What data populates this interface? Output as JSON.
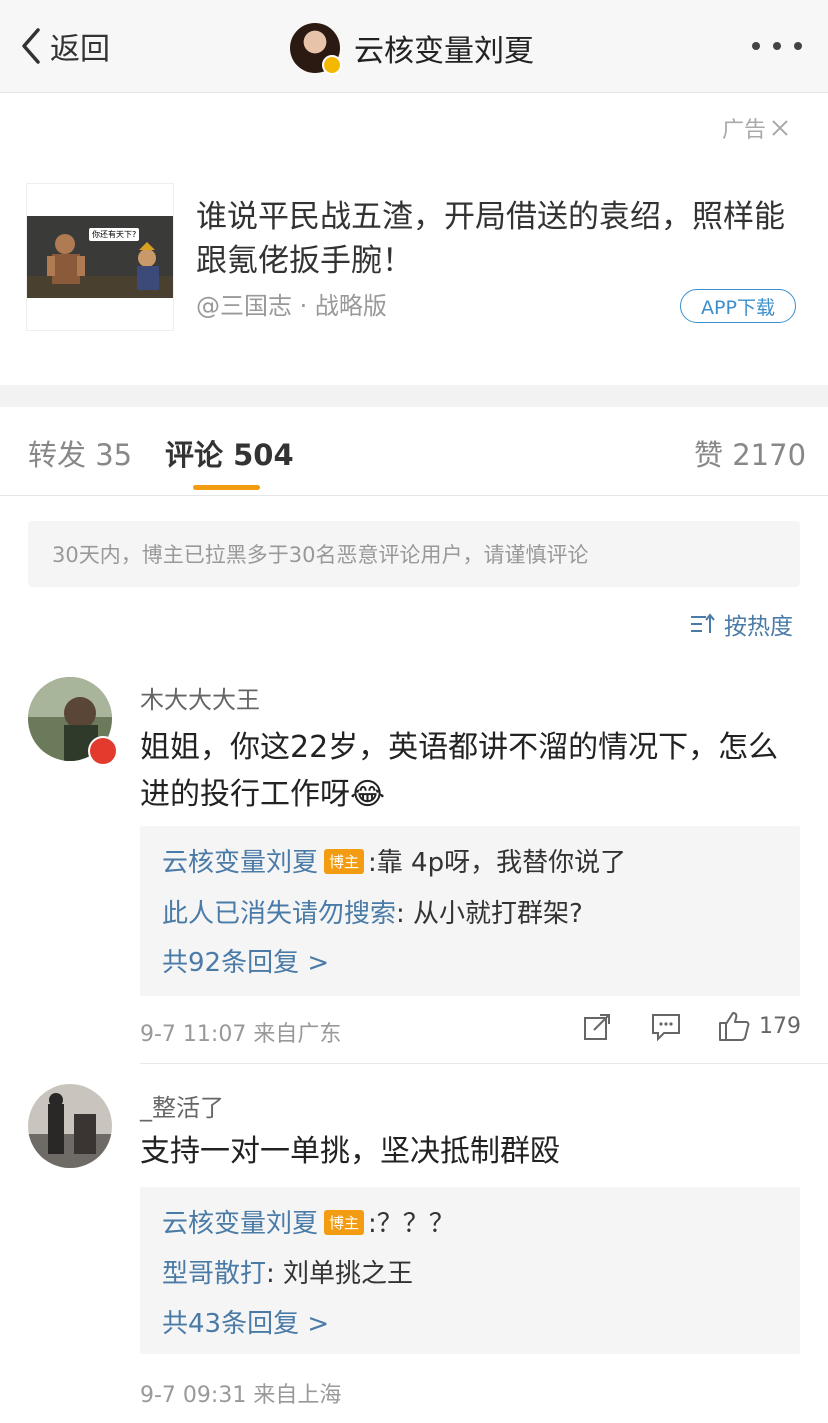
{
  "header": {
    "back_label": "返回",
    "title": "云核变量刘夏"
  },
  "ad": {
    "tag": "广告",
    "thumb_text": "你还有天下?",
    "text": "谁说平民战五渣，开局借送的袁绍，照样能跟氪佬扳手腕！",
    "source": "@三国志 · 战略版",
    "button": "APP下载"
  },
  "tabs": {
    "repost": "转发 35",
    "comment": "评论 504",
    "like": "赞 2170"
  },
  "notice": "30天内，博主已拉黑多于30名恶意评论用户，请谨慎评论",
  "sort_label": "按热度",
  "comments": [
    {
      "user": "木大大大王",
      "text": "姐姐，你这22岁，英语都讲不溜的情况下，怎么进的投行工作呀",
      "emoji": "😂",
      "replies": [
        {
          "user": "云核变量刘夏",
          "badge": "博主",
          "text": ":靠 4p呀，我替你说了"
        },
        {
          "user": "此人已消失请勿搜索",
          "text": ": 从小就打群架?"
        }
      ],
      "more": "共92条回复 >",
      "meta": "9-7 11:07 来自广东",
      "likes": "179"
    },
    {
      "user": "_整活了",
      "text": "支持一对一单挑，坚决抵制群殴",
      "replies": [
        {
          "user": "云核变量刘夏",
          "badge": "博主",
          "text": ":？？？"
        },
        {
          "user": "型哥散打",
          "text": ": 刘单挑之王"
        }
      ],
      "more": "共43条回复 >",
      "meta": "9-7 09:31 来自上海"
    }
  ]
}
